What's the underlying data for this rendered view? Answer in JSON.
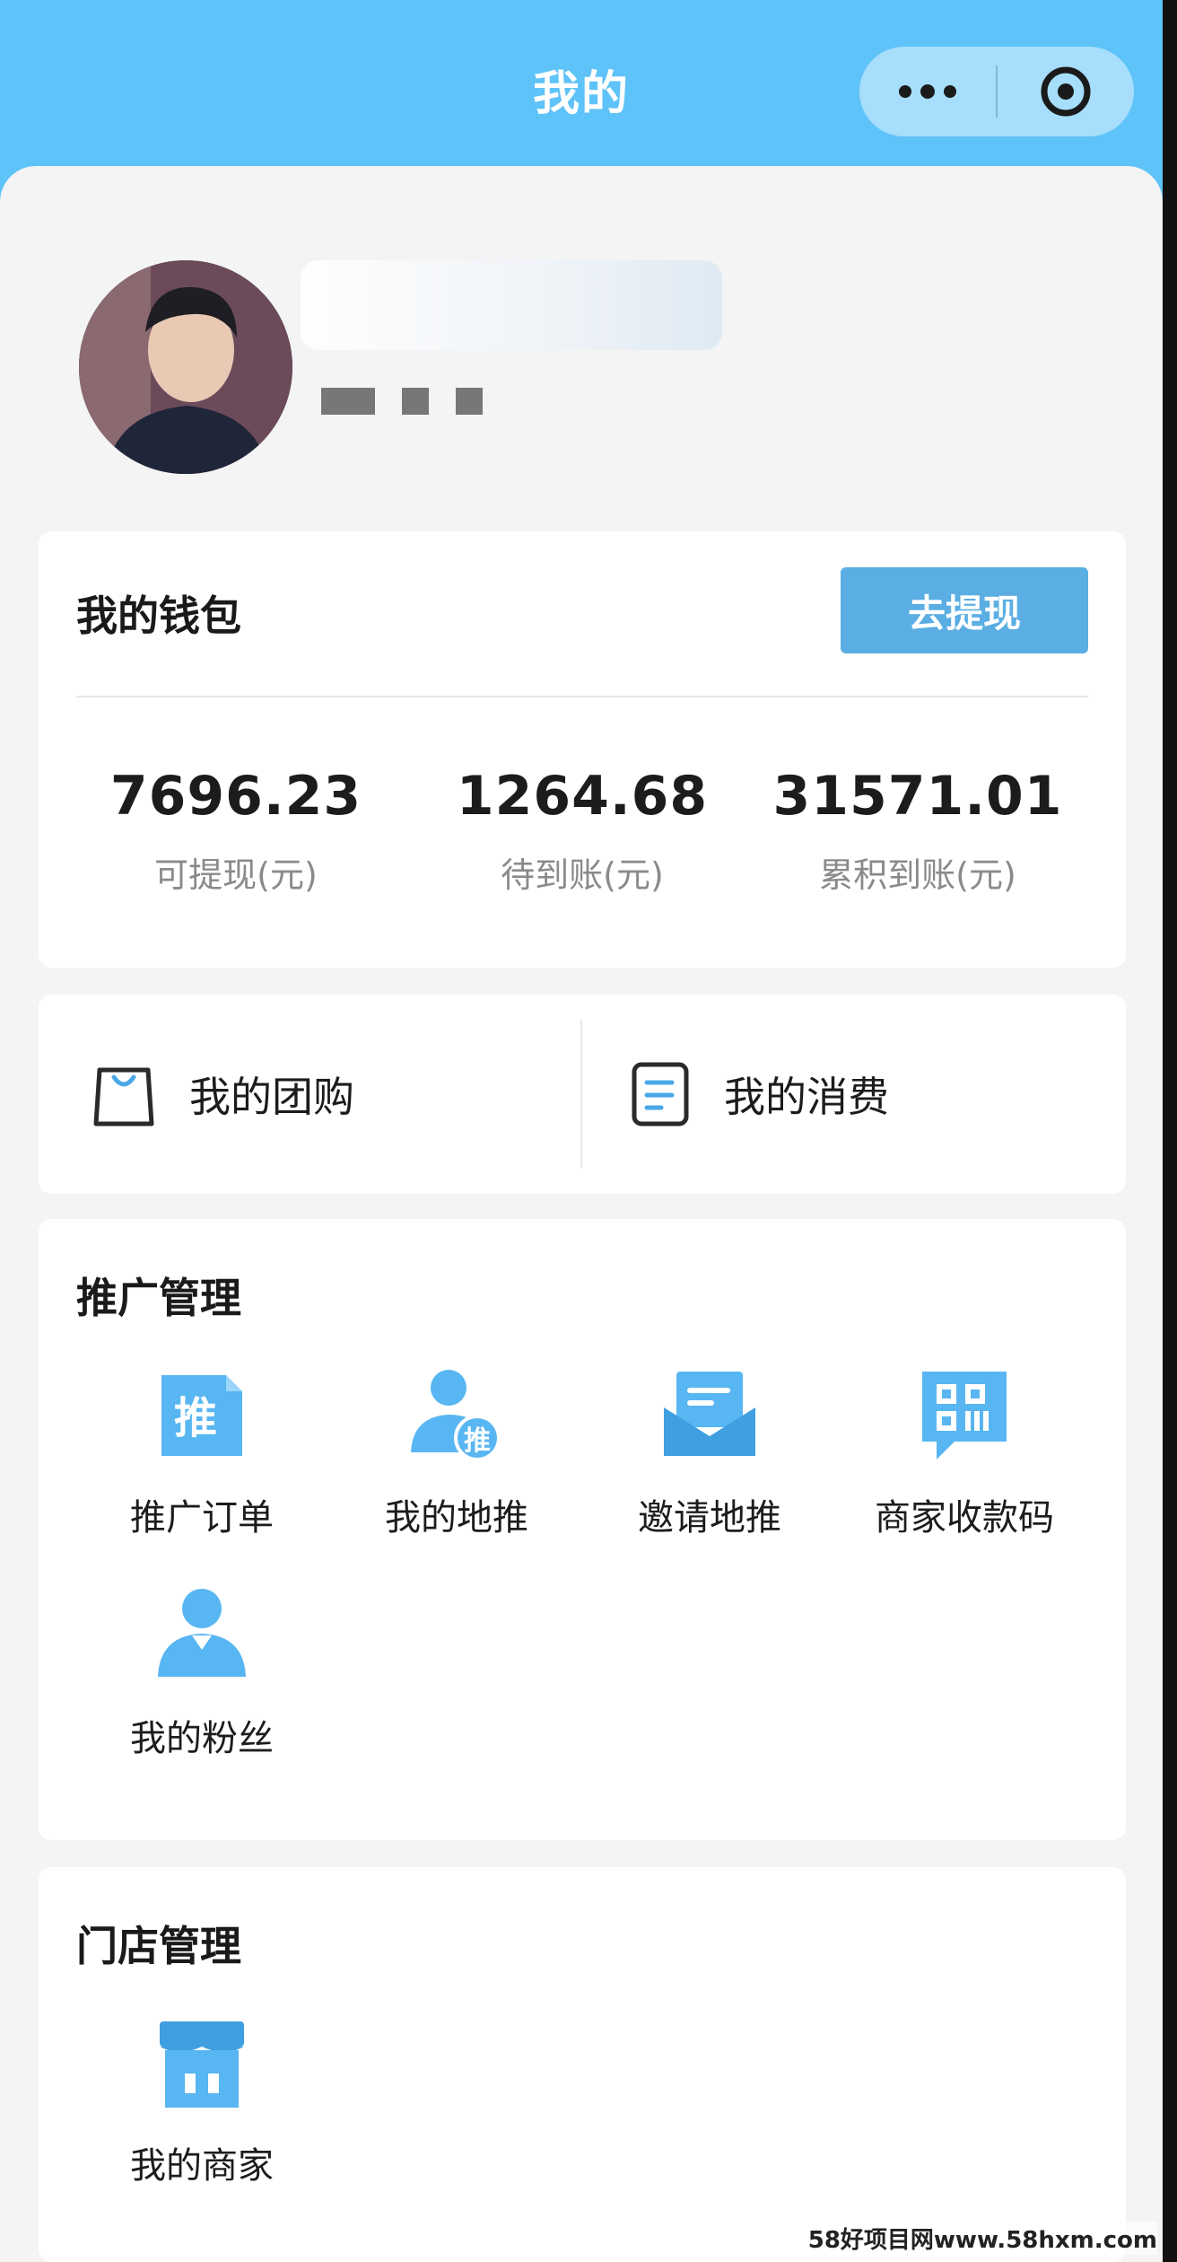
{
  "header": {
    "title": "我的"
  },
  "wallet": {
    "title": "我的钱包",
    "withdraw_label": "去提现",
    "stats": [
      {
        "value": "7696.23",
        "label": "可提现(元)"
      },
      {
        "value": "1264.68",
        "label": "待到账(元)"
      },
      {
        "value": "31571.01",
        "label": "累积到账(元)"
      }
    ]
  },
  "shortcuts": [
    {
      "label": "我的团购",
      "icon": "shopping-bag-icon"
    },
    {
      "label": "我的消费",
      "icon": "receipt-icon"
    }
  ],
  "promotion": {
    "title": "推广管理",
    "items": [
      {
        "label": "推广订单",
        "icon": "promo-order-icon",
        "glyph": "推"
      },
      {
        "label": "我的地推",
        "icon": "promoter-user-icon",
        "glyph": "推"
      },
      {
        "label": "邀请地推",
        "icon": "invite-envelope-icon"
      },
      {
        "label": "商家收款码",
        "icon": "qr-code-icon"
      },
      {
        "label": "我的粉丝",
        "icon": "fans-user-icon"
      }
    ]
  },
  "store": {
    "title": "门店管理",
    "items": [
      {
        "label": "我的商家",
        "icon": "shop-icon"
      }
    ]
  },
  "watermark": "58好项目网www.58hxm.com",
  "colors": {
    "header": "#5ec3f8",
    "accent": "#5aaee3",
    "icon_blue": "#58b6f2"
  }
}
